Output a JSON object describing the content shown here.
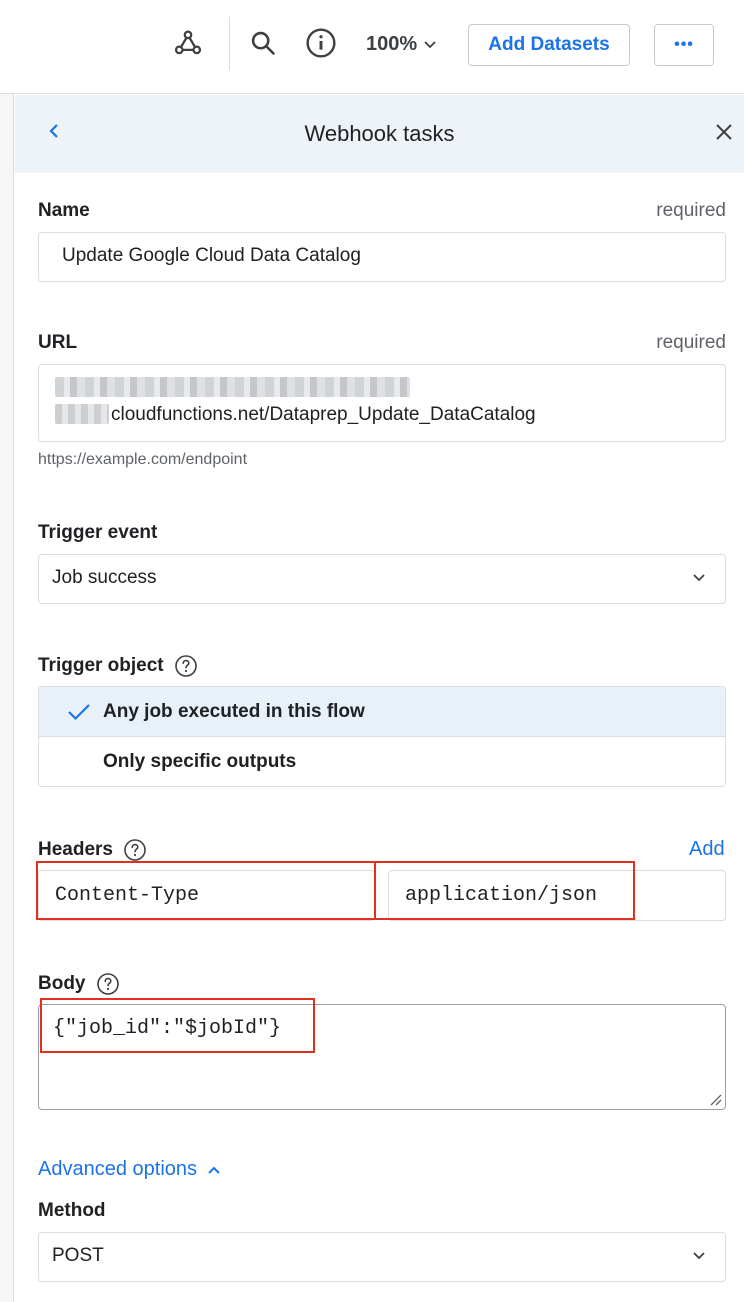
{
  "toolbar": {
    "icons": [
      "webhook-icon",
      "search-icon",
      "info-icon",
      "chevron-down-icon"
    ],
    "zoom": "100%",
    "add_datasets": "Add Datasets",
    "more": "•••"
  },
  "panel": {
    "title": "Webhook tasks",
    "back_icon": "chevron-left-icon",
    "close_icon": "close-icon"
  },
  "form": {
    "name": {
      "label": "Name",
      "required": "required",
      "value": "Update Google Cloud Data Catalog"
    },
    "url": {
      "label": "URL",
      "required": "required",
      "value_visible": "cloudfunctions.net/Dataprep_Update_DataCatalog",
      "hint": "https://example.com/endpoint"
    },
    "trigger_event": {
      "label": "Trigger event",
      "value": "Job success"
    },
    "trigger_object": {
      "label": "Trigger object",
      "options": [
        {
          "label": "Any job executed in this flow",
          "selected": true
        },
        {
          "label": "Only specific outputs",
          "selected": false
        }
      ]
    },
    "headers": {
      "label": "Headers",
      "add": "Add",
      "key": "Content-Type",
      "value": "application/json"
    },
    "body": {
      "label": "Body",
      "value": "{\"job_id\":\"$jobId\"}"
    },
    "advanced": {
      "label": "Advanced options"
    },
    "method": {
      "label": "Method",
      "value": "POST"
    }
  },
  "colors": {
    "accent": "#1a73e8",
    "highlight_box": "#e0301e",
    "selected_bg": "#e8f0fa"
  }
}
